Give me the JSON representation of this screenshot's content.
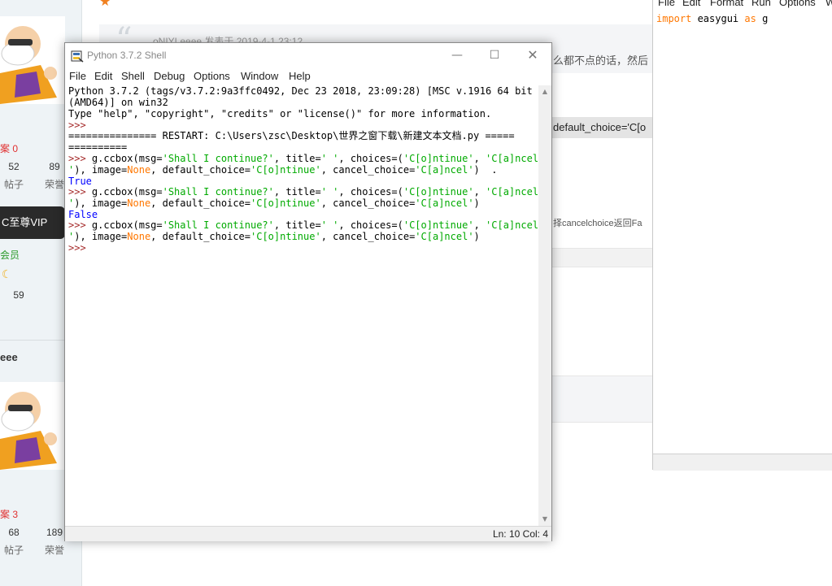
{
  "forum": {
    "quote_author": "oNIYLeeee 发表于 2019-4-1 23:12",
    "quote_text": "么都不点的话，然后",
    "code_strip_text": "default_choice='C[o",
    "note_text": "择cancelchoice返回Fa",
    "users": [
      {
        "answers": "案 0",
        "posts": "52",
        "posts_label": "帖子",
        "prestige": "89",
        "prestige_label": "荣誉"
      },
      {
        "answers": "案 3",
        "posts": "68",
        "posts_label": "帖子",
        "prestige": "189",
        "prestige_label": "荣誉"
      }
    ],
    "vip_badge": "C至尊VIP",
    "member_label": "会员",
    "member_points": "59",
    "username": "eee"
  },
  "editor": {
    "menu": [
      "File",
      "Edit",
      "Format",
      "Run",
      "Options",
      "W"
    ],
    "code": {
      "kw_import": "import",
      "module": " easygui ",
      "kw_as": "as",
      "alias": " g"
    }
  },
  "shell": {
    "title": "Python 3.7.2 Shell",
    "menu": [
      "File",
      "Edit",
      "Shell",
      "Debug",
      "Options",
      "Window",
      "Help"
    ],
    "lines": {
      "l1": "Python 3.7.2 (tags/v3.7.2:9a3ffc0492, Dec 23 2018, 23:09:28) [MSC v.1916 64 bit",
      "l2": "(AMD64)] on win32",
      "l3": "Type \"help\", \"copyright\", \"credits\" or \"license()\" for more information.",
      "l4": ">>> ",
      "l5": "=============== RESTART: C:\\Users\\zsc\\Desktop\\世界之窗下载\\新建文本文档.py =====",
      "l6": "==========",
      "prompt": ">>> ",
      "call_a": "g.ccbox(msg=",
      "msg": "'Shall I continue?'",
      "call_b": ", title=",
      "title_val": "' '",
      "call_c": ", choices=(",
      "ch1": "'C[o]ntinue'",
      "comma": ", ",
      "ch2": "'C[a]ncel",
      "cont1": "'",
      "cont2": "), image=",
      "none": "None",
      "cont3": ", default_choice=",
      "dc": "'C[o]ntinue'",
      "cont4": ", cancel_choice=",
      "cc": "'C[a]ncel'",
      "cont5": ")",
      "dot": "  .",
      "result_true": "True",
      "result_false": "False",
      "final_prompt": ">>>"
    },
    "status": "Ln: 10  Col: 4"
  }
}
